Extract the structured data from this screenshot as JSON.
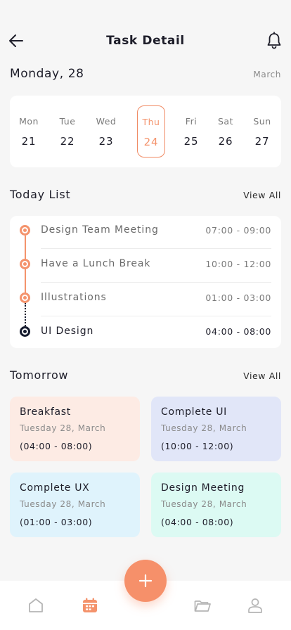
{
  "header": {
    "title": "Task Detail",
    "back_icon": "arrow-left-icon",
    "bell_icon": "bell-icon"
  },
  "date": {
    "title": "Monday, 28",
    "month": "March"
  },
  "week": [
    {
      "name": "Mon",
      "num": "21",
      "active": false
    },
    {
      "name": "Tue",
      "num": "22",
      "active": false
    },
    {
      "name": "Wed",
      "num": "23",
      "active": false
    },
    {
      "name": "Thu",
      "num": "24",
      "active": true
    },
    {
      "name": "Fri",
      "num": "25",
      "active": false
    },
    {
      "name": "Sat",
      "num": "26",
      "active": false
    },
    {
      "name": "Sun",
      "num": "27",
      "active": false
    }
  ],
  "today": {
    "title": "Today List",
    "view_all": "View All",
    "tasks": [
      {
        "name": "Design Team Meeting",
        "time": "07:00 - 09:00",
        "state": "done"
      },
      {
        "name": "Have a Lunch Break",
        "time": "10:00 - 12:00",
        "state": "done"
      },
      {
        "name": "Illustrations",
        "time": "01:00 - 03:00",
        "state": "done"
      },
      {
        "name": "UI Design",
        "time": "04:00 - 08:00",
        "state": "current"
      }
    ]
  },
  "tomorrow": {
    "title": "Tomorrow",
    "view_all": "View All",
    "cards": [
      {
        "title": "Breakfast",
        "date": "Tuesday 28, March",
        "time": "(04:00 - 08:00)",
        "color": "#fdebe4"
      },
      {
        "title": "Complete UI",
        "date": "Tuesday 28, March",
        "time": "(10:00 - 12:00)",
        "color": "#e1e6f8"
      },
      {
        "title": "Complete UX",
        "date": "Tuesday 28, March",
        "time": "(01:00 - 03:00)",
        "color": "#dff3fc"
      },
      {
        "title": "Design Meeting",
        "date": "Tuesday 28, March",
        "time": "(04:00 - 08:00)",
        "color": "#dcfaf3"
      }
    ]
  },
  "nav": {
    "items": [
      "home-icon",
      "calendar-icon",
      "folder-icon",
      "profile-icon"
    ],
    "active": "calendar-icon",
    "fab_icon": "plus-icon"
  },
  "colors": {
    "accent": "#f4936c",
    "dark": "#141a2e",
    "inactive_icon": "#b5b5b5"
  }
}
